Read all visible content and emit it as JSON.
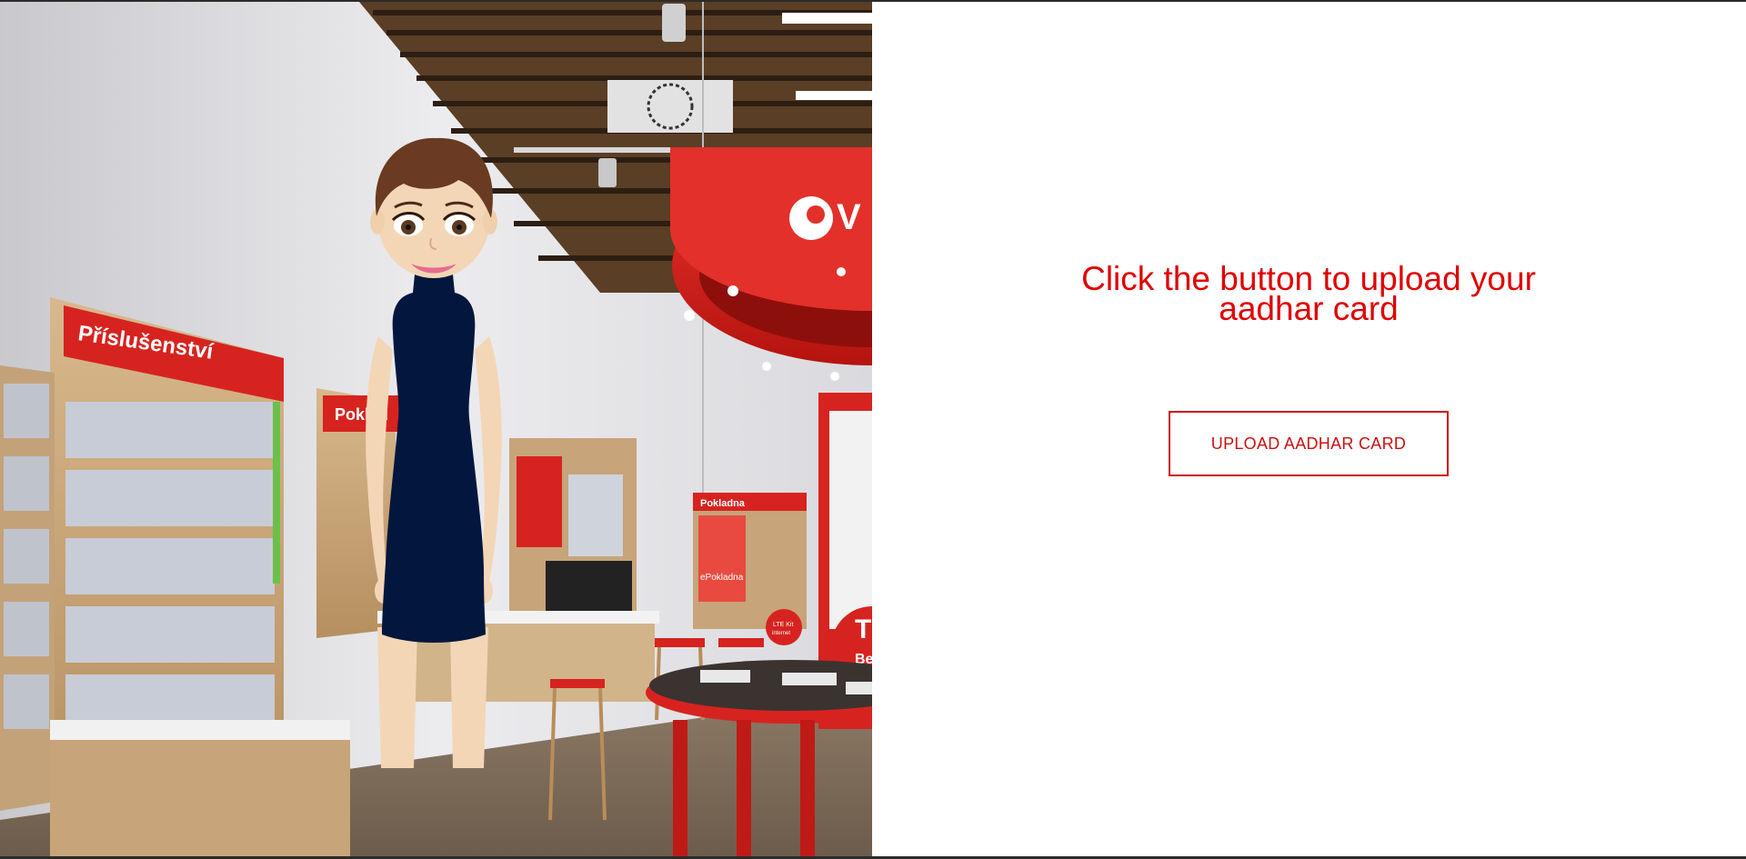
{
  "scene": {
    "store_sign_accessories": "Příslušenství",
    "store_sign_checkout_partial": "Poklad",
    "store_sign_checkout": "Pokladna",
    "brand_partial": "V",
    "promo_partial": "T",
    "promo_partial2": "Be",
    "lte_badge_line1": "LTE Kit",
    "lte_badge_line2": "internet",
    "epokladna_label": "ePokladna"
  },
  "avatar": {
    "icon": "assistant-avatar-icon"
  },
  "panel": {
    "prompt_line1": "Click the button to upload your",
    "prompt_line2": "aadhar card",
    "upload_button_label": "UPLOAD AADHAR CARD"
  },
  "colors": {
    "accent": "#e00000",
    "button_border": "#cc1111",
    "store_red": "#d7231f",
    "dress": "#03163d"
  }
}
